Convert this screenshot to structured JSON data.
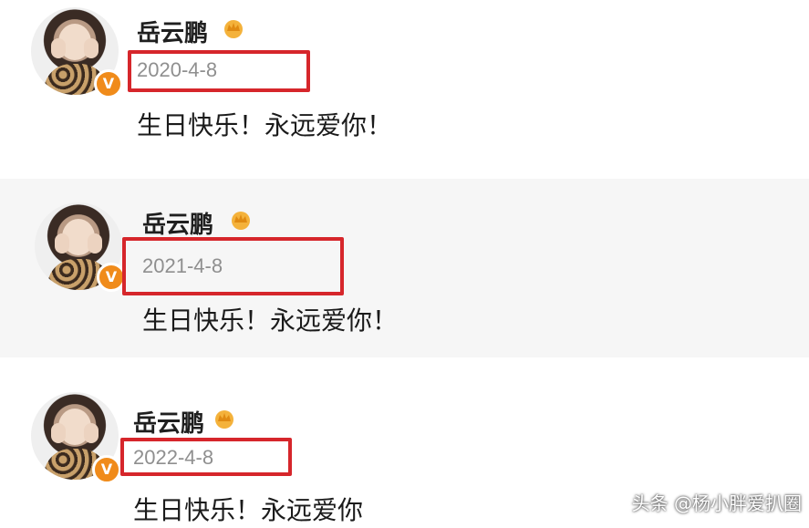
{
  "posts": [
    {
      "name": "岳云鹏",
      "date": "2020-4-8",
      "content": "生日快乐！永远爱你！"
    },
    {
      "name": "岳云鹏",
      "date": "2021-4-8",
      "content": "生日快乐！永远爱你！"
    },
    {
      "name": "岳云鹏",
      "date": "2022-4-8",
      "content": "生日快乐！永远爱你"
    }
  ],
  "badge_icon": "verified-v-icon",
  "crown_icon": "crown-icon",
  "colors": {
    "highlight_box": "#d6262b",
    "badge": "#f08b1a",
    "crown": "#f4b23b"
  },
  "watermark": "头条 @杨小胖爱扒圈"
}
